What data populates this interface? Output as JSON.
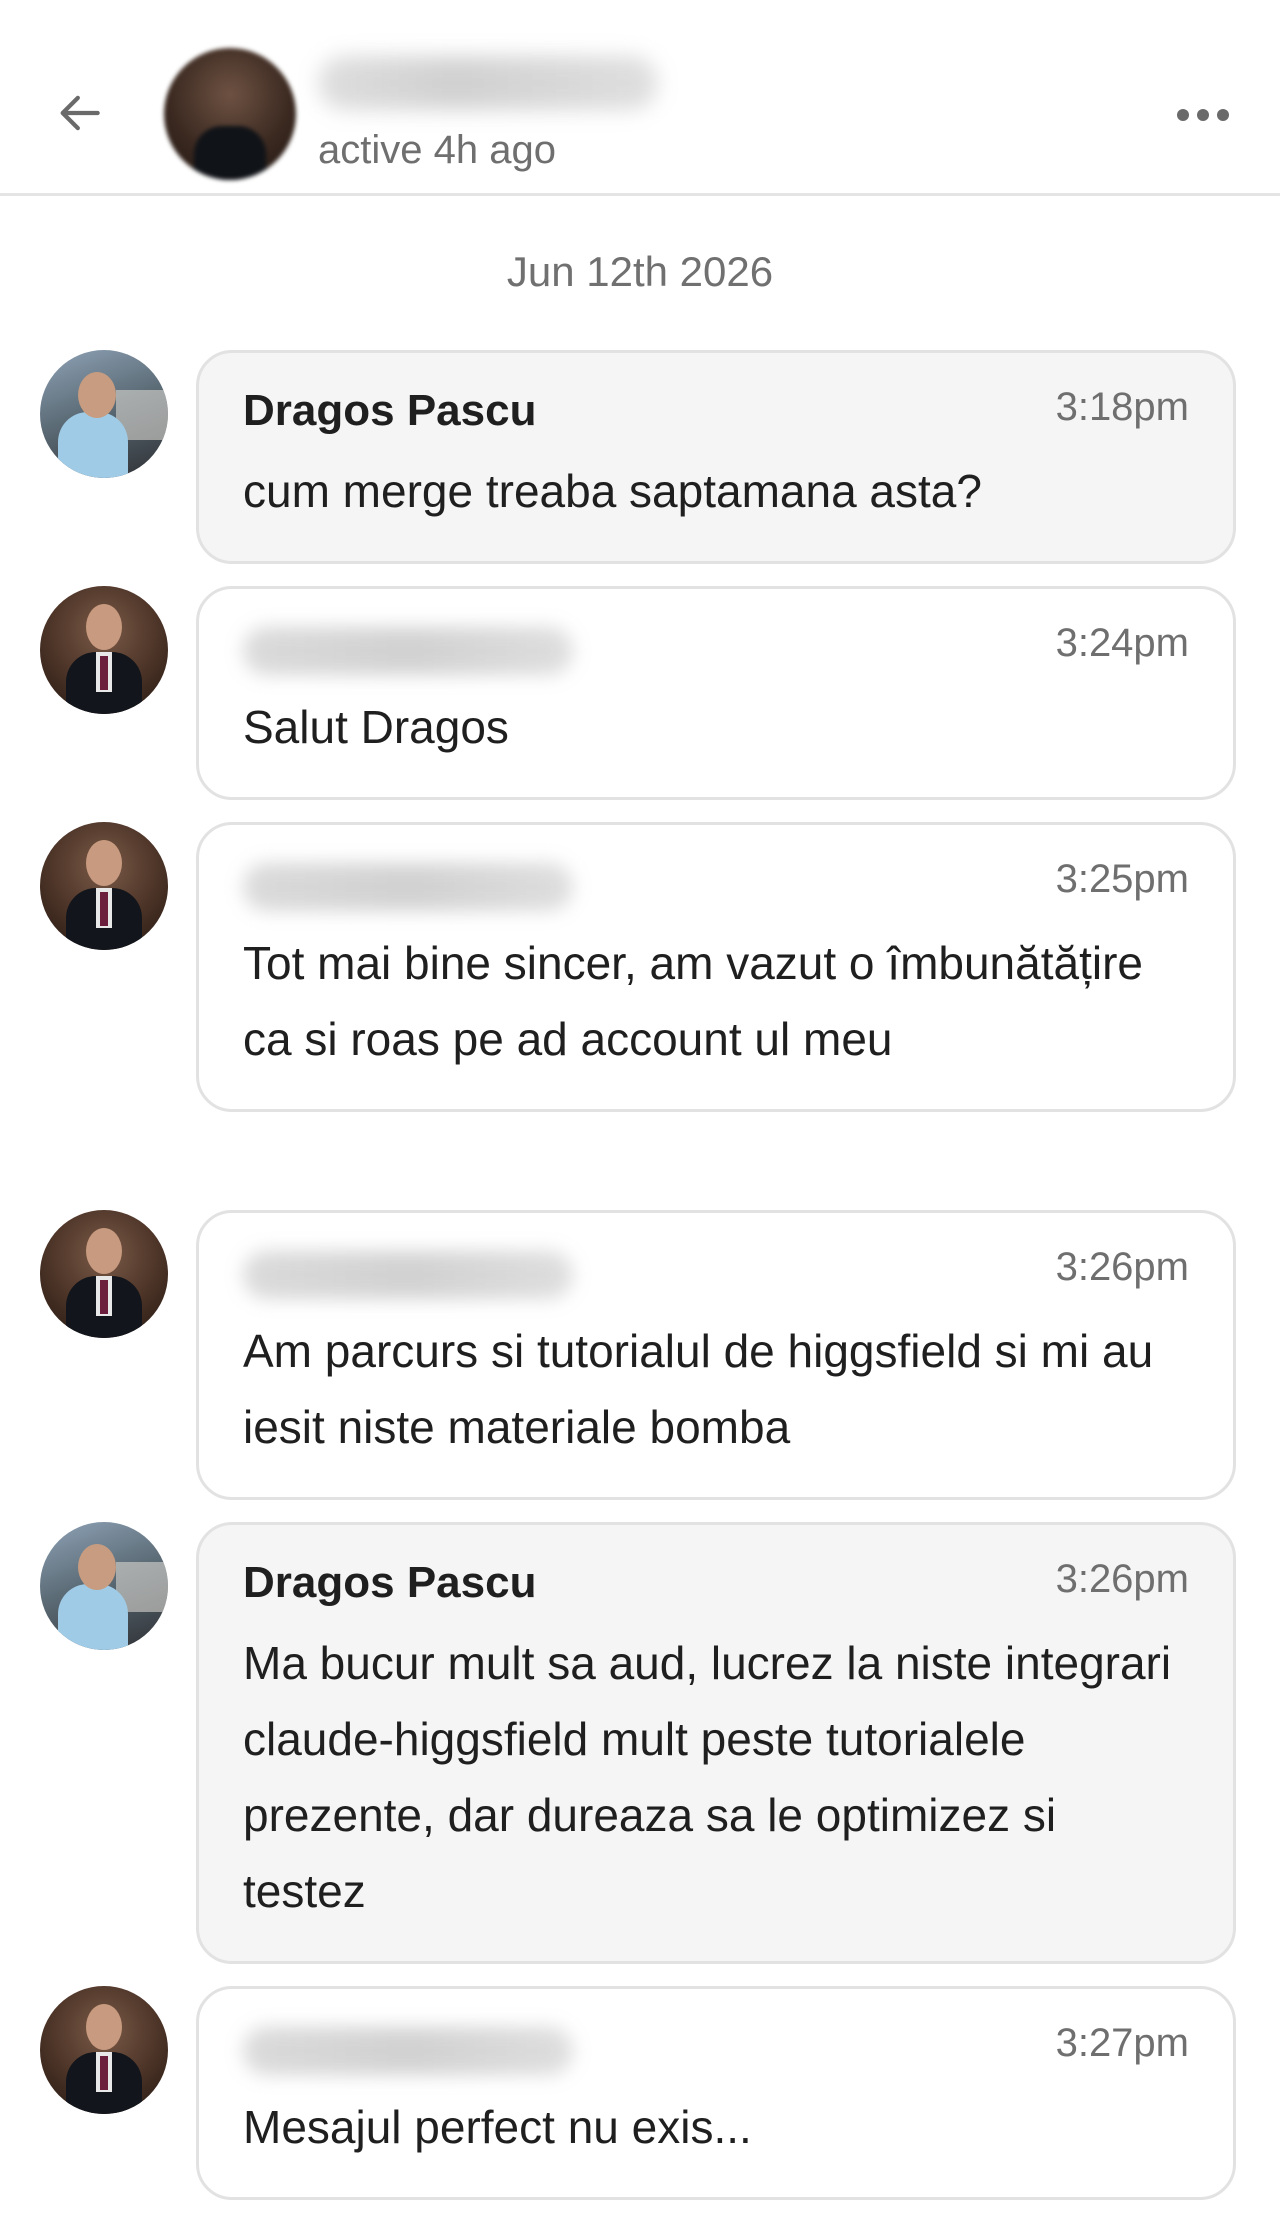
{
  "header": {
    "status": "active 4h ago"
  },
  "conversation": {
    "date": "Jun 12th 2026",
    "messages": [
      {
        "sender": "Dragos Pascu",
        "time": "3:18pm",
        "text": "cum merge treaba saptamana asta?"
      },
      {
        "sender": "",
        "time": "3:24pm",
        "text": "Salut Dragos"
      },
      {
        "sender": "",
        "time": "3:25pm",
        "text": "Tot mai bine sincer, am vazut o îmbunătățire ca si roas pe ad account ul meu"
      },
      {
        "sender": "",
        "time": "3:26pm",
        "text": "Am parcurs si tutorialul de higgsfield si mi au iesit niste materiale bomba"
      },
      {
        "sender": "Dragos Pascu",
        "time": "3:26pm",
        "text": "Ma bucur mult sa aud, lucrez la niste integrari claude-higgsfield mult peste tutorialele prezente, dar dureaza sa le optimizez si testez"
      },
      {
        "sender": "",
        "time": "3:27pm",
        "text": "Mesajul perfect nu exis..."
      }
    ]
  },
  "icons": {
    "back": "arrow-left-icon",
    "more": "more-horizontal-icon"
  },
  "colors": {
    "incoming_bubble": "#f5f5f5",
    "outgoing_bubble": "#ffffff",
    "border": "#e2e2e2",
    "muted_text": "#6f6f6f"
  }
}
